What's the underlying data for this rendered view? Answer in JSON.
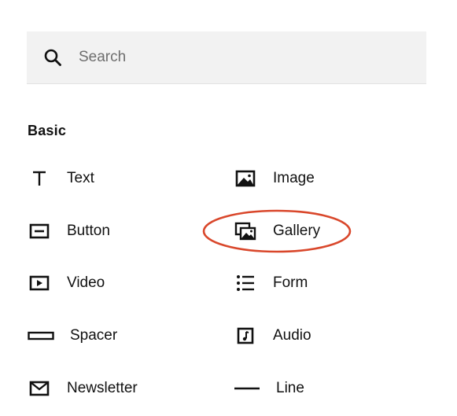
{
  "search": {
    "placeholder": "Search",
    "value": ""
  },
  "section": {
    "title": "Basic"
  },
  "blocks": {
    "text": {
      "label": "Text",
      "icon": "text-icon"
    },
    "image": {
      "label": "Image",
      "icon": "image-icon"
    },
    "button": {
      "label": "Button",
      "icon": "button-icon"
    },
    "gallery": {
      "label": "Gallery",
      "icon": "gallery-icon",
      "highlighted": true
    },
    "video": {
      "label": "Video",
      "icon": "video-icon"
    },
    "form": {
      "label": "Form",
      "icon": "form-icon"
    },
    "spacer": {
      "label": "Spacer",
      "icon": "spacer-icon"
    },
    "audio": {
      "label": "Audio",
      "icon": "audio-icon"
    },
    "newsletter": {
      "label": "Newsletter",
      "icon": "newsletter-icon"
    },
    "line": {
      "label": "Line",
      "icon": "line-icon"
    }
  },
  "colors": {
    "search_bg": "#f2f2f2",
    "text": "#111111",
    "placeholder": "#6e6e6e",
    "highlight": "#d9472b"
  }
}
